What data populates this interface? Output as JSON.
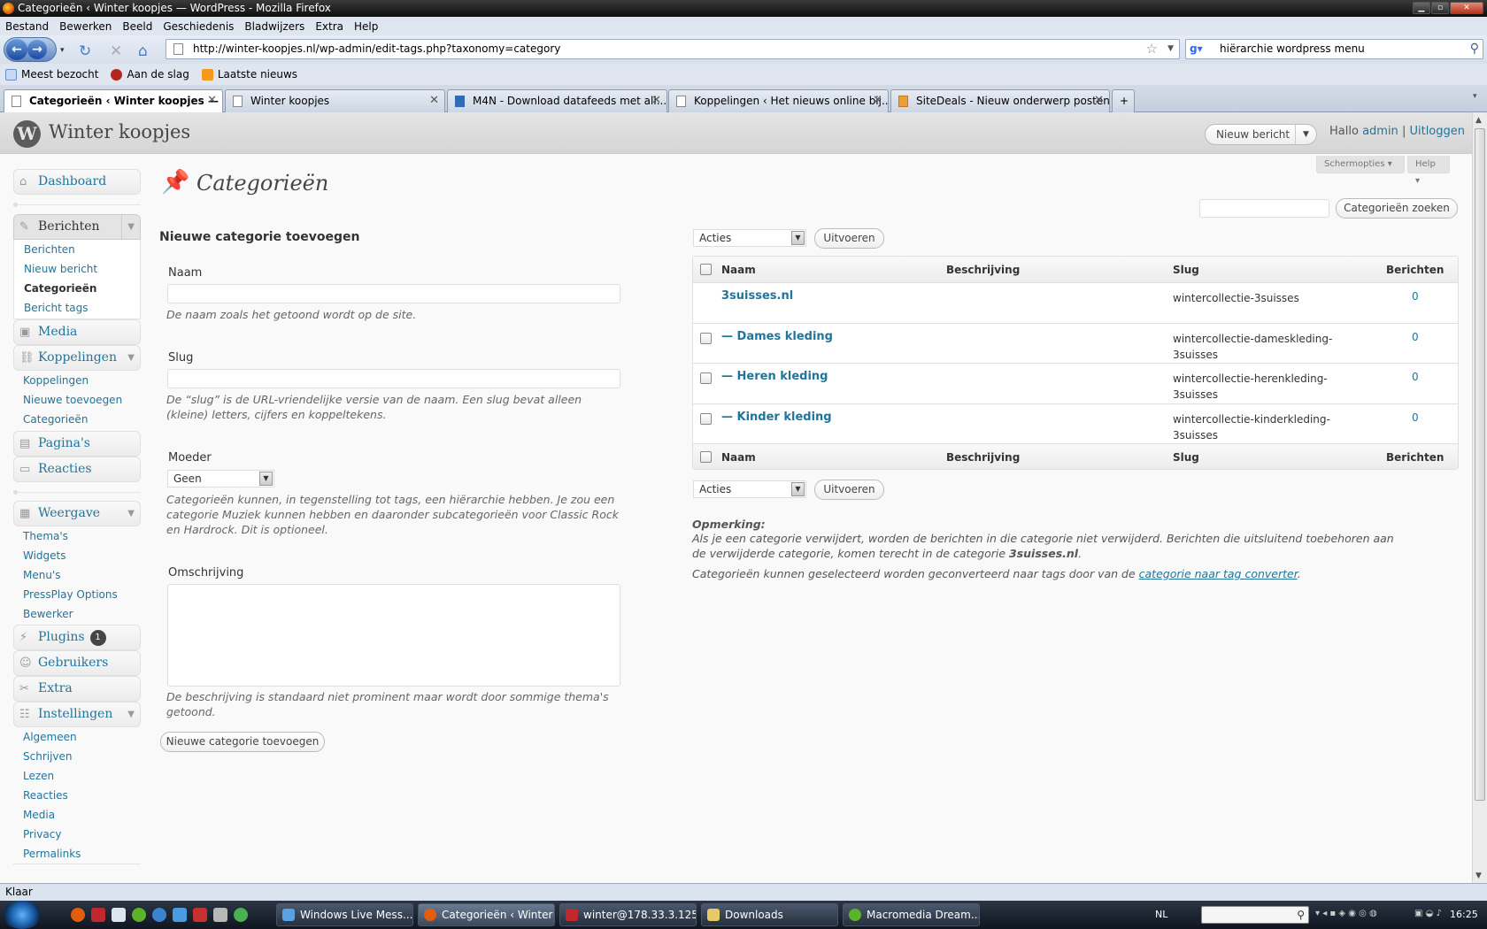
{
  "window": {
    "title": "Categorieën ‹ Winter koopjes — WordPress - Mozilla Firefox"
  },
  "menubar": [
    "Bestand",
    "Bewerken",
    "Beeld",
    "Geschiedenis",
    "Bladwijzers",
    "Extra",
    "Help"
  ],
  "url": "http://winter-koopjes.nl/wp-admin/edit-tags.php?taxonomy=category",
  "search_query": "hiërarchie wordpress menu",
  "bookmarks": [
    "Meest bezocht",
    "Aan de slag",
    "Laatste nieuws"
  ],
  "tabs": [
    "Categorieën ‹ Winter koopjes — W...",
    "Winter koopjes",
    "M4N - Download datafeeds met all...",
    "Koppelingen ‹ Het nieuws online bij...",
    "SiteDeals - Nieuw onderwerp posten"
  ],
  "header": {
    "site_name": "Winter koopjes",
    "fav_action": "Nieuw bericht",
    "howdy": "Hallo",
    "user": "admin",
    "separator": "|",
    "logout": "Uitloggen",
    "screen_options": "Schermopties",
    "help": "Help"
  },
  "sidebar": {
    "dashboard": "Dashboard",
    "posts": "Berichten",
    "posts_sub": [
      "Berichten",
      "Nieuw bericht",
      "Categorieën",
      "Bericht tags"
    ],
    "media": "Media",
    "links": "Koppelingen",
    "links_sub": [
      "Koppelingen",
      "Nieuwe toevoegen",
      "Categorieën"
    ],
    "pages": "Pagina's",
    "comments": "Reacties",
    "appearance": "Weergave",
    "appearance_sub": [
      "Thema's",
      "Widgets",
      "Menu's",
      "PressPlay Options",
      "Bewerker"
    ],
    "plugins": "Plugins",
    "plugins_badge": "1",
    "users": "Gebruikers",
    "tools": "Extra",
    "settings": "Instellingen",
    "settings_sub": [
      "Algemeen",
      "Schrijven",
      "Lezen",
      "Reacties",
      "Media",
      "Privacy",
      "Permalinks"
    ]
  },
  "page": {
    "title": "Categorieën",
    "search_button": "Categorieën zoeken"
  },
  "form": {
    "heading": "Nieuwe categorie toevoegen",
    "name_label": "Naam",
    "name_desc": "De naam zoals het getoond wordt op de site.",
    "slug_label": "Slug",
    "slug_desc": "De “slug” is de URL-vriendelijke versie van de naam. Een slug bevat alleen (kleine) letters, cijfers en koppeltekens.",
    "parent_label": "Moeder",
    "parent_value": "Geen",
    "parent_desc": "Categorieën kunnen, in tegenstelling tot tags, een hiërarchie hebben. Je zou een categorie Muziek kunnen hebben en daaronder subcategorieën voor Classic Rock en Hardrock. Dit is optioneel.",
    "desc_label": "Omschrijving",
    "desc_desc": "De beschrijving is standaard niet prominent maar wordt door sommige thema's getoond.",
    "submit": "Nieuwe categorie toevoegen"
  },
  "table": {
    "bulk_action": "Acties",
    "apply": "Uitvoeren",
    "columns": [
      "Naam",
      "Beschrijving",
      "Slug",
      "Berichten"
    ],
    "rows": [
      {
        "name": "3suisses.nl",
        "slug": "wintercollectie-3suisses",
        "count": "0"
      },
      {
        "name": "— Dames kleding",
        "slug": "wintercollectie-dameskleding-3suisses",
        "count": "0"
      },
      {
        "name": "— Heren kleding",
        "slug": "wintercollectie-herenkleding-3suisses",
        "count": "0"
      },
      {
        "name": "— Kinder kleding",
        "slug": "wintercollectie-kinderkleding-3suisses",
        "count": "0"
      }
    ]
  },
  "notes": {
    "heading": "Opmerking:",
    "text1": "Als je een categorie verwijdert, worden de berichten in die categorie niet verwijderd. Berichten die uitsluitend toebehoren aan de verwijderde categorie, komen terecht in de categorie",
    "default_cat": "3suisses.nl",
    "text1_end": ".",
    "text2": "Categorieën kunnen geselecteerd worden geconverteerd naar tags door van de",
    "converter_link": "categorie naar tag converter",
    "text2_end": "."
  },
  "status": "Klaar",
  "taskbar": {
    "tasks": [
      "Windows Live Mess...",
      "Categorieën ‹ Winter ...",
      "winter@178.33.3.125...",
      "Downloads",
      "Macromedia Dream..."
    ],
    "lang": "NL",
    "clock": "16:25"
  }
}
